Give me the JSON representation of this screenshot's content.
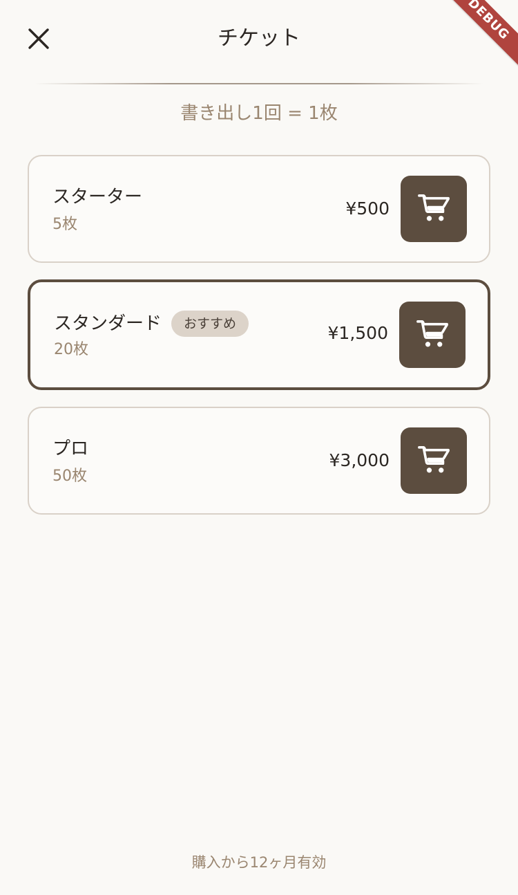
{
  "debug_banner": "DEBUG",
  "header": {
    "title": "チケット"
  },
  "subtitle": "書き出し1回 = 1枚",
  "plans": [
    {
      "name": "スターター",
      "count": "5枚",
      "price": "¥500",
      "badge": "",
      "featured": false
    },
    {
      "name": "スタンダード",
      "count": "20枚",
      "price": "¥1,500",
      "badge": "おすすめ",
      "featured": true
    },
    {
      "name": "プロ",
      "count": "50枚",
      "price": "¥3,000",
      "badge": "",
      "featured": false
    }
  ],
  "footer": {
    "note": "購入から12ヶ月有効"
  },
  "colors": {
    "background": "#faf9f6",
    "accent": "#5c4d3f",
    "muted_text": "#9a8670",
    "card_border": "#d9d1c8",
    "badge_bg": "#dcd3c9",
    "debug_ribbon": "#b0443e"
  },
  "icons": {
    "close": "close-icon",
    "cart": "shopping-cart-icon"
  }
}
